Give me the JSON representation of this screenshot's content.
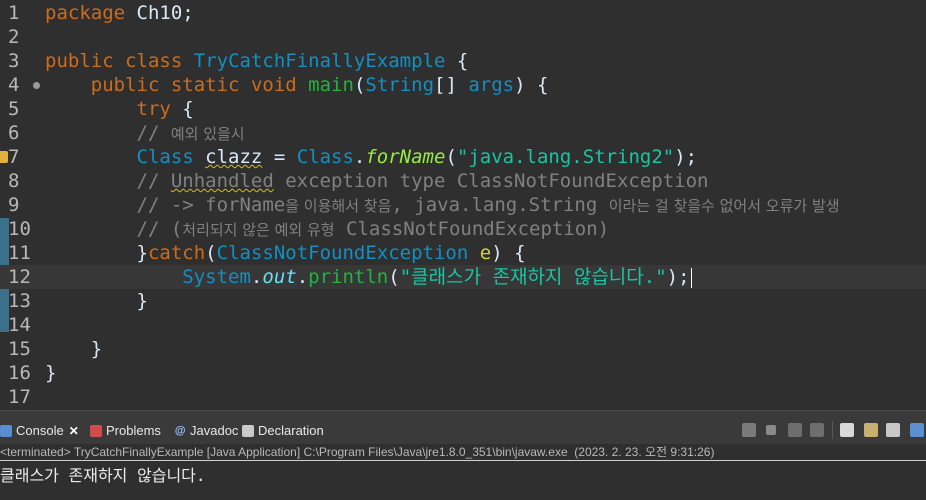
{
  "editor": {
    "line_numbers": [
      "1",
      "2",
      "3",
      "4",
      "5",
      "6",
      "7",
      "8",
      "9",
      "10",
      "11",
      "12",
      "13",
      "14",
      "15",
      "16",
      "17"
    ],
    "line1": {
      "kw": "package",
      "rest": " Ch10;"
    },
    "line3": {
      "kw1": "public",
      "kw2": "class",
      "cls": "TryCatchFinallyExample",
      "rest": " {"
    },
    "line4": {
      "kw1": "public",
      "kw2": "static",
      "kw3": "void",
      "fn": "main",
      "open": "(",
      "type": "String",
      "arr": "[] ",
      "param": "args",
      "rest": ") {"
    },
    "line5": {
      "kw": "try",
      "rest": " {"
    },
    "line6": {
      "slashes": "// ",
      "text": "예외 있을시"
    },
    "line7": {
      "cls1": "Class",
      "var": "clazz",
      "eq": " = ",
      "cls2": "Class",
      "dot": ".",
      "method": "forName",
      "open": "(",
      "str": "\"java.lang.String2\"",
      "rest": ");"
    },
    "line8": {
      "pre": "// ",
      "err": "Unhandled",
      "post": " exception type ClassNotFoundException"
    },
    "line9": {
      "pre": "// -> forName",
      "k1": "을 이용해서 찾음",
      "mid": ", java.lang.String ",
      "k2": "이라는 걸 찾을수 없어서 오류가 발생"
    },
    "line10": {
      "pre": "// (",
      "k1": "처리되지 않은 예외 유형",
      "post": " ClassNotFoundException)"
    },
    "line11": {
      "brace": "}",
      "kw": "catch",
      "open": "(",
      "cls": "ClassNotFoundException",
      "param": "e",
      "rest": ") {"
    },
    "line12": {
      "cls": "System",
      "dot1": ".",
      "field": "out",
      "dot2": ".",
      "method": "println",
      "open": "(",
      "str": "\"클래스가 존재하지 않습니다.\"",
      "rest": ");"
    },
    "line13": {
      "text": "}"
    },
    "line15": {
      "text": "}"
    },
    "line16": {
      "text": "}"
    }
  },
  "tabs": {
    "console": "Console",
    "problems": "Problems",
    "javadoc": "Javadoc",
    "declaration": "Declaration",
    "javadoc_icon": "@",
    "close": "✕"
  },
  "console": {
    "header": "<terminated> TryCatchFinallyExample [Java Application] C:\\Program Files\\Java\\jre1.8.0_351\\bin\\javaw.exe  (2023. 2. 23. 오전 9:31:26)",
    "output": "클래스가 존재하지 않습니다."
  },
  "colors": {
    "keyword": "#cc6c1d",
    "class": "#1290c3",
    "string": "#17c6a3",
    "comment": "#808080",
    "method": "#1eb540",
    "background": "#2f2f2f"
  }
}
